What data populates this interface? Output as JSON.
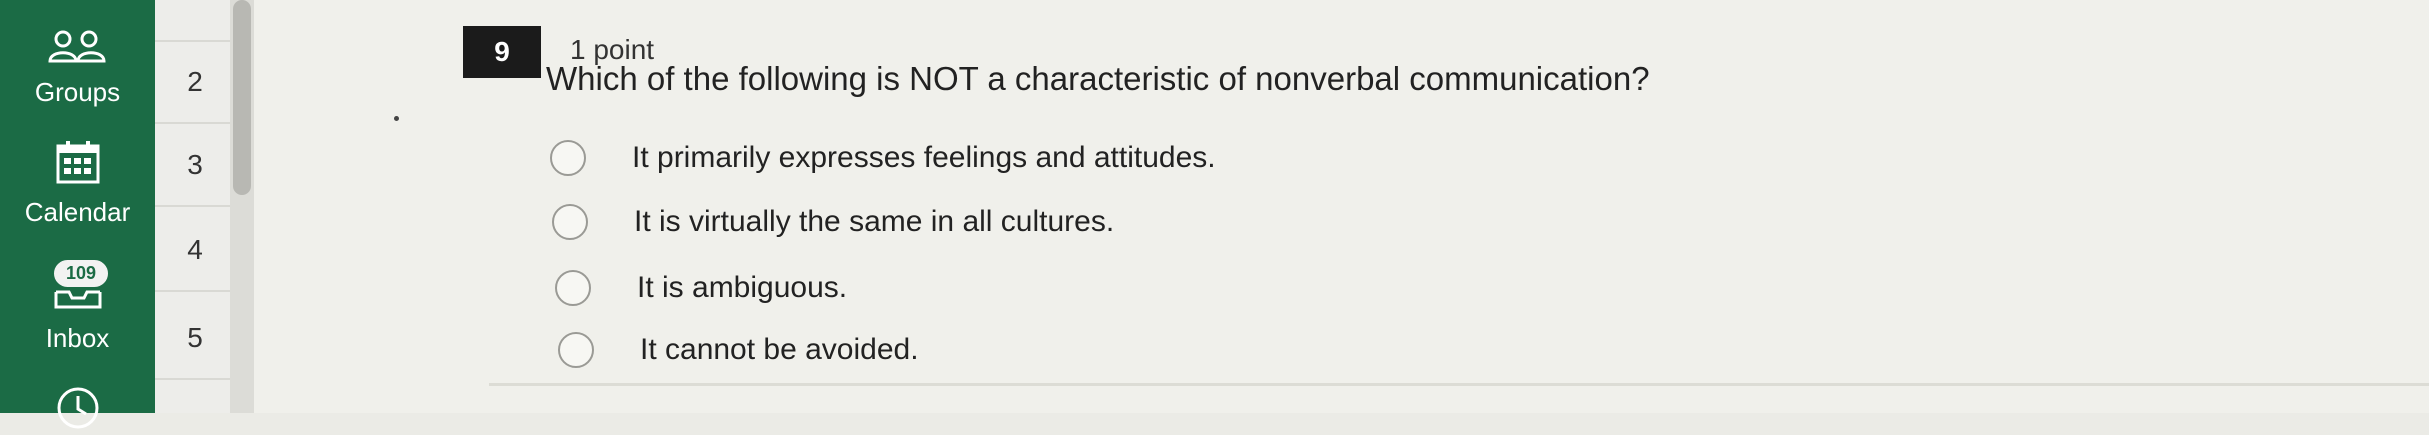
{
  "global_nav": {
    "groups_label": "Groups",
    "calendar_label": "Calendar",
    "inbox_label": "Inbox",
    "inbox_badge": "109"
  },
  "question_nav": {
    "items": [
      "2",
      "3",
      "4",
      "5"
    ]
  },
  "question": {
    "number": "9",
    "points": "1 point",
    "text": "Which of the following is NOT a characteristic of nonverbal communication?",
    "options": [
      "It primarily expresses feelings and attitudes.",
      "It is virtually the same in all cultures.",
      "It is ambiguous.",
      "It cannot be avoided."
    ]
  },
  "colors": {
    "nav_green": "#1b6b45",
    "background": "#f0f0eb",
    "question_number_box": "#1b1b1b"
  }
}
